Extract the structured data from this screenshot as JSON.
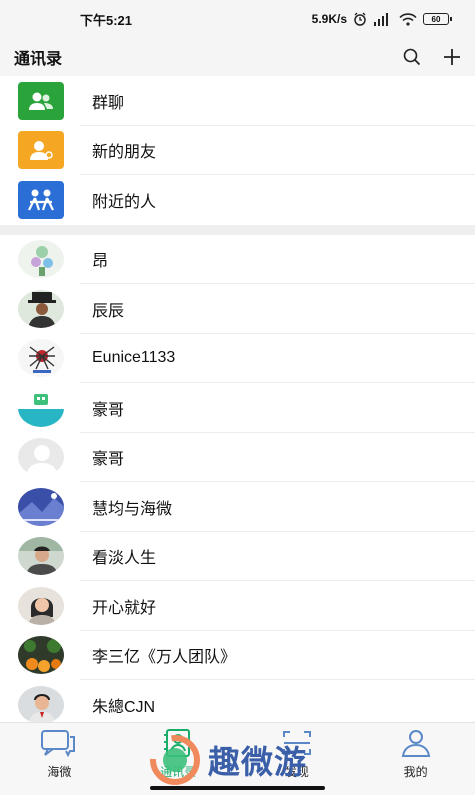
{
  "status": {
    "time": "下午5:21",
    "network_speed": "5.9K/s",
    "battery": "60"
  },
  "header": {
    "title": "通讯录",
    "icons": [
      "search-icon",
      "plus-icon"
    ]
  },
  "functions": [
    {
      "label": "群聊",
      "icon": "group-chat-icon",
      "color": "#2aa33b"
    },
    {
      "label": "新的朋友",
      "icon": "new-friend-icon",
      "color": "#f5a623"
    },
    {
      "label": "附近的人",
      "icon": "nearby-people-icon",
      "color": "#2b6fd6"
    }
  ],
  "contacts": [
    {
      "name": "昂"
    },
    {
      "name": "辰辰"
    },
    {
      "name": "Eunice1133"
    },
    {
      "name": "豪哥"
    },
    {
      "name": "豪哥"
    },
    {
      "name": "慧均与海微"
    },
    {
      "name": "看淡人生"
    },
    {
      "name": "开心就好"
    },
    {
      "name": "李三亿《万人团队》"
    },
    {
      "name": "朱總CJN"
    }
  ],
  "tabs": [
    {
      "label": "海微",
      "icon": "chat-icon"
    },
    {
      "label": "通讯录",
      "icon": "contacts-icon",
      "active": true
    },
    {
      "label": "发现",
      "icon": "discover-icon"
    },
    {
      "label": "我的",
      "icon": "profile-icon"
    }
  ],
  "watermark": {
    "text": "趣微游"
  },
  "colors": {
    "accent": "#1aad6a",
    "background": "#f5f5f5"
  }
}
